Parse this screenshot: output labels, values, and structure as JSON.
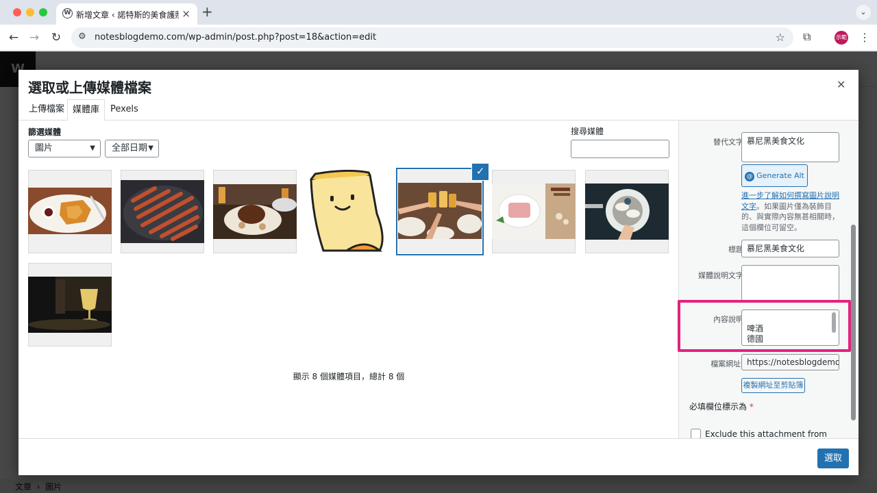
{
  "browser": {
    "tab_title": "新增文章 ‹ 諾特斯的美食護照 —",
    "url": "notesblogdemo.com/wp-admin/post.php?post=18&action=edit",
    "profile_label": "示範"
  },
  "modal": {
    "title": "選取或上傳媒體檔案",
    "tabs": [
      "上傳檔案",
      "媒體庫",
      "Pexels"
    ],
    "active_tab": "媒體庫",
    "filter_label": "篩選媒體",
    "type_filter": "圖片",
    "date_filter": "全部日期",
    "search_label": "搜尋媒體",
    "search_value": "",
    "status_text": "顯示 8 個媒體項目，總計 8 個",
    "select_button": "選取",
    "media_items": [
      {
        "desc": "fried schnitzel plate",
        "selected": false
      },
      {
        "desc": "sausages on grill",
        "selected": false
      },
      {
        "desc": "pork knuckle dish",
        "selected": false
      },
      {
        "desc": "cartoon sticky note",
        "selected": false
      },
      {
        "desc": "toasting beer table",
        "selected": true
      },
      {
        "desc": "meat loaf slices",
        "selected": false
      },
      {
        "desc": "white sausage plate",
        "selected": false
      },
      {
        "desc": "glass of beer",
        "selected": false
      }
    ]
  },
  "sidebar": {
    "alt_label": "替代文字",
    "alt_value": "慕尼黑美食文化",
    "generate_alt": "Generate Alt",
    "help_link": "進一步了解如何撰寫圖片說明文字",
    "help_text": "。如果圖片僅為裝飾目的、與實際內容無甚相關時，這個欄位可留空。",
    "title_label": "標題",
    "title_value": "慕尼黑美食文化",
    "caption_label": "媒體說明文字",
    "caption_value": "",
    "description_label": "內容說明",
    "description_value": "啤酒\n德國\n慕尼黑",
    "file_url_label": "檔案網址:",
    "file_url_value": "https://notesblogdemo.c",
    "copy_url": "複製網址至剪貼簿",
    "required_note": "必填欄位標示為",
    "required_star": "*",
    "exclude_label": "Exclude this attachment from"
  },
  "editor": {
    "breadcrumb_1": "文章",
    "breadcrumb_2": "圖片"
  },
  "colors": {
    "accent": "#2271b1",
    "highlight": "#e2237e"
  }
}
